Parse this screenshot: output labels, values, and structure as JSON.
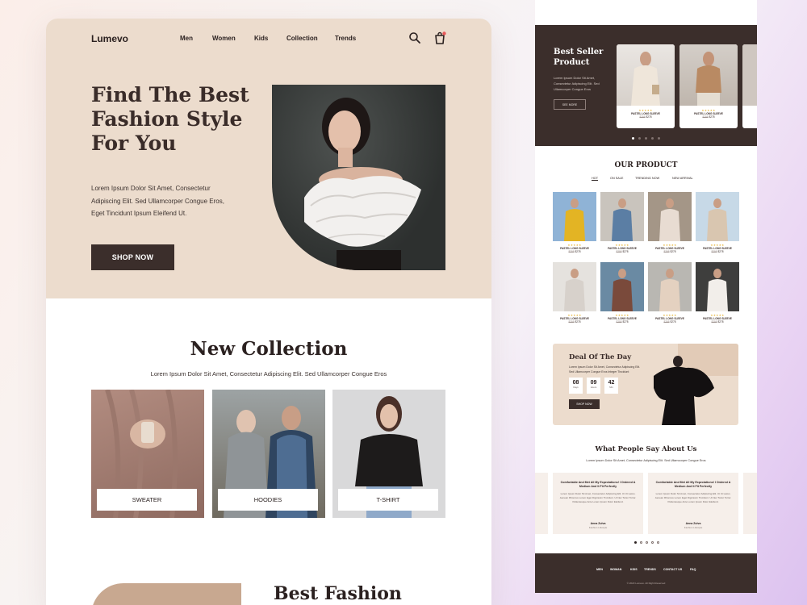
{
  "main": {
    "header": {
      "brand": "Lumevo",
      "nav": [
        "Men",
        "Women",
        "Kids",
        "Collection",
        "Trends"
      ]
    },
    "hero": {
      "title_lines": [
        "Find The Best",
        "Fashion Style",
        "For You"
      ],
      "description_lines": [
        "Lorem Ipsum Dolor Sit Amet, Consectetur",
        "Adipiscing Elit. Sed Ullamcorper Congue Eros,",
        "Eget Tincidunt Ipsum Eleifend Ut."
      ],
      "cta": "SHOP NOW"
    },
    "new_collection": {
      "title": "New Collection",
      "description": "Lorem Ipsum Dolor Sit Amet, Consectetur Adipiscing Elit. Sed Ullamcorper Congue Eros",
      "cards": [
        "SWEATER",
        "HOODIES",
        "T-SHIRT"
      ]
    },
    "best_fashion": {
      "title": "Best Fashion"
    }
  },
  "side": {
    "best_seller": {
      "title_lines": [
        "Best Seller",
        "Product"
      ],
      "description": "Lorem Ipsum Dolor Sit Amet, Consectetur Adipiscing Elit. Sed Ullamcorper Congue Eros",
      "see_more": "SEE MORE",
      "products": [
        {
          "name": "PASTEL LONG SLEEVE",
          "old_price": "$298",
          "price": "$278",
          "stars": "★★★★★"
        },
        {
          "name": "PASTEL LONG SLEEVE",
          "old_price": "$298",
          "price": "$278",
          "stars": "★★★★★"
        }
      ]
    },
    "our_product": {
      "title": "OUR PRODUCT",
      "tabs": [
        "HOT",
        "ON SALE",
        "TRENDING NOW",
        "NEW ARRIVAL"
      ],
      "item": {
        "name": "PASTEL LONG SLEEVE",
        "old_price": "$298",
        "price": "$278",
        "stars": "★★★★★"
      }
    },
    "deal": {
      "title": "Deal Of The Day",
      "description": "Lorem Ipsum Dolor Sit Amet, Consectetur Adipiscing Elit. Sed Ullamcorper Congue Eros Integer Tincidunt",
      "countdown": [
        {
          "value": "08",
          "label": "Days"
        },
        {
          "value": "09",
          "label": "Hours"
        },
        {
          "value": "42",
          "label": "Min"
        }
      ],
      "button": "SHOP NOW"
    },
    "testimonials": {
      "title": "What People Say About Us",
      "description": "Lorem Ipsum Dolor Sit Amet, Consectetur Adipiscing Elit. Sed Ullamcorper Congue Eros",
      "cards": [
        {
          "quote": "Comfortable And Met All My Expectations! I Ordered A Medium And It Fit Perfectly",
          "text": "Lorem Ipsum Dolor Sit Amet, Consectetur Adipiscing Elit. Ut Ut Lacus. Aenean Rhoncus Lorem Eget Dignissim Tincidunt. Ut Nec Tortor Tortor. Pellentesque Ante Lorem Ipsum Dolor Eleifend.",
          "name": "Anna Zulva",
          "role": "Fashion Lifestyle"
        },
        {
          "quote": "Comfortable And Met All My Expectations! I Ordered A Medium And It Fit Perfectly",
          "text": "Lorem Ipsum Dolor Sit Amet, Consectetur Adipiscing Elit. Ut Ut Lacus. Aenean Rhoncus Lorem Eget Dignissim Tincidunt. Ut Nec Tortor Tortor. Pellentesque Ante Lorem Ipsum Dolor Eleifend.",
          "name": "Anna Zulva",
          "role": "Fashion Lifestyle"
        }
      ]
    },
    "footer": {
      "nav": [
        "MEN",
        "WOMAN",
        "KIDS",
        "TRENDS",
        "CONTACT US",
        "FAQ"
      ],
      "copyright": "© 2023 Lumevo. All Right Reserved"
    }
  },
  "colors": {
    "accent_dark": "#3b2e2b",
    "hero_beige": "#ecdccd",
    "cart_badge": "#e85a5a",
    "star": "#e7b63c"
  },
  "icons": [
    "search-icon",
    "cart-icon"
  ]
}
